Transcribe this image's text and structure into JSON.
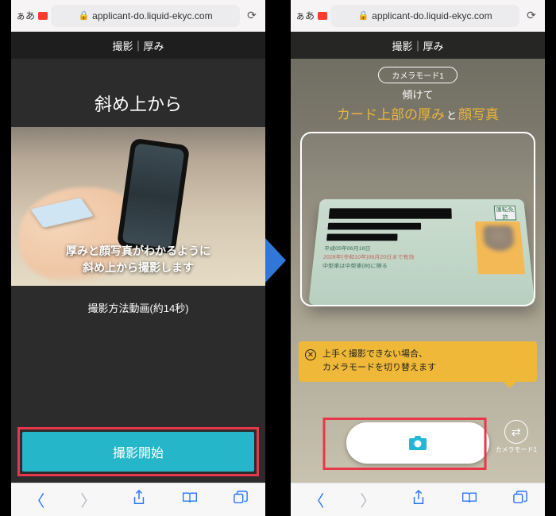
{
  "browser": {
    "aa": "ぁあ",
    "url": "applicant-do.liquid-ekyc.com"
  },
  "left": {
    "header": "撮影｜厚み",
    "title": "斜め上から",
    "overlay_line1": "厚みと顔写真がわかるように",
    "overlay_line2": "斜め上から撮影します",
    "video_caption": "撮影方法動画(約14秒)",
    "start_button": "撮影開始"
  },
  "right": {
    "header": "撮影｜厚み",
    "mode_pill": "カメラモード1",
    "tilt_label": "傾けて",
    "hl_part1": "カード上部の厚み",
    "hl_and": "と",
    "hl_part2": "顔写真",
    "card_text1": "平成05年06月18日",
    "card_text2": "2028年(令和10年)06月20日まで有効",
    "card_text3": "中型車は中型車(8t)に限る",
    "card_stamp": "運転免許",
    "banner_line1": "上手く撮影できない場合、",
    "banner_line2": "カメラモードを切り替えます",
    "mode_switch_label": "カメラモード1"
  }
}
